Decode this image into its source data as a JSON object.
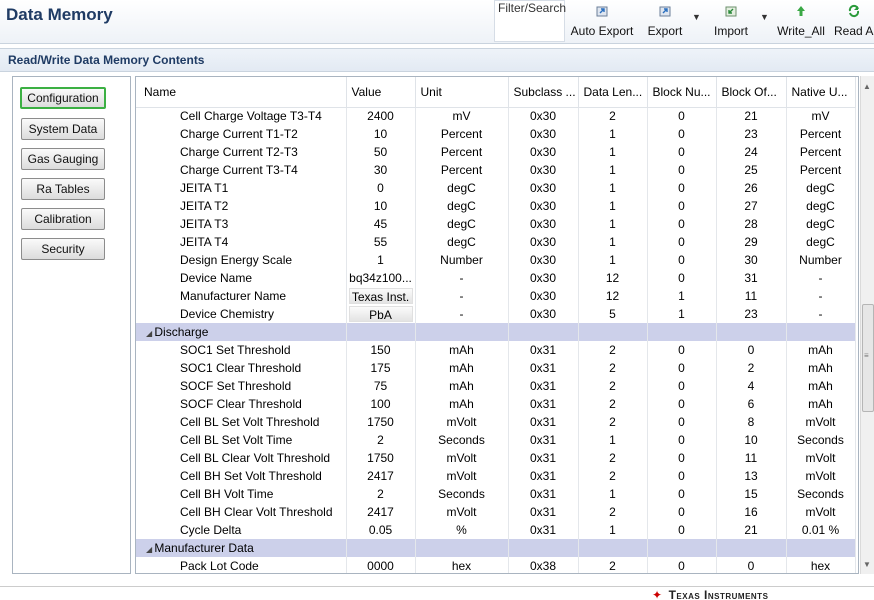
{
  "app": {
    "title": "Data Memory"
  },
  "toolbar": {
    "filter_label": "Filter/Search",
    "buttons": [
      {
        "label": "Auto Export",
        "icon": "auto-export-icon"
      },
      {
        "label": "Export",
        "icon": "export-icon"
      },
      {
        "label": "Import",
        "icon": "import-icon"
      },
      {
        "label": "Write_All",
        "icon": "write-all-icon"
      },
      {
        "label": "Read All",
        "icon": "read-all-icon"
      }
    ]
  },
  "section": {
    "title": "Read/Write Data Memory Contents"
  },
  "nav": {
    "items": [
      "Configuration",
      "System Data",
      "Gas Gauging",
      "Ra Tables",
      "Calibration",
      "Security"
    ],
    "active": "Configuration"
  },
  "table": {
    "columns": [
      "Name",
      "Value",
      "Unit",
      "Subclass ...",
      "Data Len...",
      "Block Nu...",
      "Block Of...",
      "Native U..."
    ],
    "rows": [
      [
        "Cell Charge Voltage T3-T4",
        "2400",
        "mV",
        "0x30",
        "2",
        "0",
        "21",
        "mV"
      ],
      [
        "Charge Current T1-T2",
        "10",
        "Percent",
        "0x30",
        "1",
        "0",
        "23",
        "Percent"
      ],
      [
        "Charge Current  T2-T3",
        "50",
        "Percent",
        "0x30",
        "1",
        "0",
        "24",
        "Percent"
      ],
      [
        "Charge Current  T3-T4",
        "30",
        "Percent",
        "0x30",
        "1",
        "0",
        "25",
        "Percent"
      ],
      [
        "JEITA T1",
        "0",
        "degC",
        "0x30",
        "1",
        "0",
        "26",
        "degC"
      ],
      [
        "JEITA T2",
        "10",
        "degC",
        "0x30",
        "1",
        "0",
        "27",
        "degC"
      ],
      [
        "JEITA T3",
        "45",
        "degC",
        "0x30",
        "1",
        "0",
        "28",
        "degC"
      ],
      [
        "JEITA T4",
        "55",
        "degC",
        "0x30",
        "1",
        "0",
        "29",
        "degC"
      ],
      [
        "Design Energy Scale",
        "1",
        "Number",
        "0x30",
        "1",
        "0",
        "30",
        "Number"
      ],
      [
        "Device Name",
        "bq34z100...",
        "-",
        "0x30",
        "12",
        "0",
        "31",
        "-"
      ],
      [
        "Manufacturer Name",
        "Texas Inst.",
        "-",
        "0x30",
        "12",
        "1",
        "11",
        "-"
      ],
      [
        "Device Chemistry",
        "PbA",
        "-",
        "0x30",
        "5",
        "1",
        "23",
        "-"
      ],
      {
        "category": "Discharge"
      },
      [
        "SOC1 Set Threshold",
        "150",
        "mAh",
        "0x31",
        "2",
        "0",
        "0",
        "mAh"
      ],
      [
        "SOC1 Clear Threshold",
        "175",
        "mAh",
        "0x31",
        "2",
        "0",
        "2",
        "mAh"
      ],
      [
        "SOCF Set Threshold",
        "75",
        "mAh",
        "0x31",
        "2",
        "0",
        "4",
        "mAh"
      ],
      [
        "SOCF Clear Threshold",
        "100",
        "mAh",
        "0x31",
        "2",
        "0",
        "6",
        "mAh"
      ],
      [
        "Cell BL Set Volt Threshold",
        "1750",
        "mVolt",
        "0x31",
        "2",
        "0",
        "8",
        "mVolt"
      ],
      [
        "Cell BL Set Volt Time",
        "2",
        "Seconds",
        "0x31",
        "1",
        "0",
        "10",
        "Seconds"
      ],
      [
        "Cell BL Clear Volt Threshold",
        "1750",
        "mVolt",
        "0x31",
        "2",
        "0",
        "11",
        "mVolt"
      ],
      [
        "Cell BH Set Volt Threshold",
        "2417",
        "mVolt",
        "0x31",
        "2",
        "0",
        "13",
        "mVolt"
      ],
      [
        "Cell BH Volt Time",
        "2",
        "Seconds",
        "0x31",
        "1",
        "0",
        "15",
        "Seconds"
      ],
      [
        "Cell BH  Clear Volt Threshold",
        "2417",
        "mVolt",
        "0x31",
        "2",
        "0",
        "16",
        "mVolt"
      ],
      [
        "Cycle Delta",
        "0.05",
        "%",
        "0x31",
        "1",
        "0",
        "21",
        "0.01 %"
      ],
      {
        "category": "Manufacturer Data"
      },
      [
        "Pack Lot Code",
        "0000",
        "hex",
        "0x38",
        "2",
        "0",
        "0",
        "hex"
      ]
    ]
  },
  "footer": {
    "brand": "Texas Instruments"
  },
  "colors": {
    "title": "#1f3b64",
    "category_row": "#ccd0ea",
    "active_nav_border": "#3cb043",
    "brand_red": "#cc0000"
  }
}
